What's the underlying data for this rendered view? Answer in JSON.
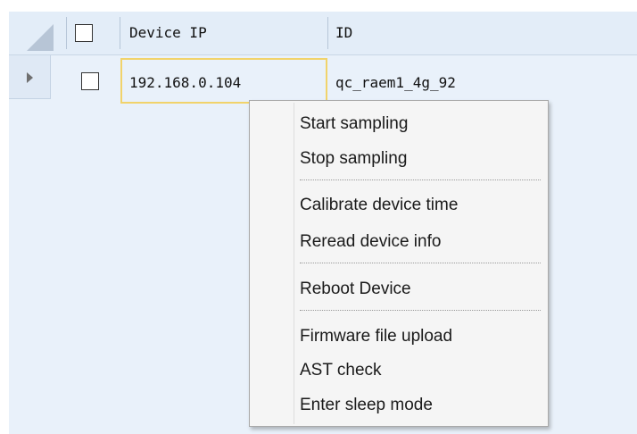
{
  "grid": {
    "columns": [
      {
        "label": "Device IP"
      },
      {
        "label": "ID"
      }
    ],
    "rows": [
      {
        "device_ip": "192.168.0.104",
        "id": "qc_raem1_4g_92",
        "checked": false
      }
    ]
  },
  "context_menu": {
    "items": [
      {
        "label": "Start sampling"
      },
      {
        "label": "Stop sampling"
      },
      {
        "label": "Calibrate device time"
      },
      {
        "label": "Reread device info"
      },
      {
        "label": "Reboot Device"
      },
      {
        "label": "Firmware file upload"
      },
      {
        "label": "AST check"
      },
      {
        "label": "Enter sleep mode"
      }
    ]
  },
  "colors": {
    "panel_background": "#e9f1fa",
    "header_background": "#e3edf8",
    "selected_cell_border": "#f1d36b",
    "menu_background": "#f5f5f5"
  }
}
